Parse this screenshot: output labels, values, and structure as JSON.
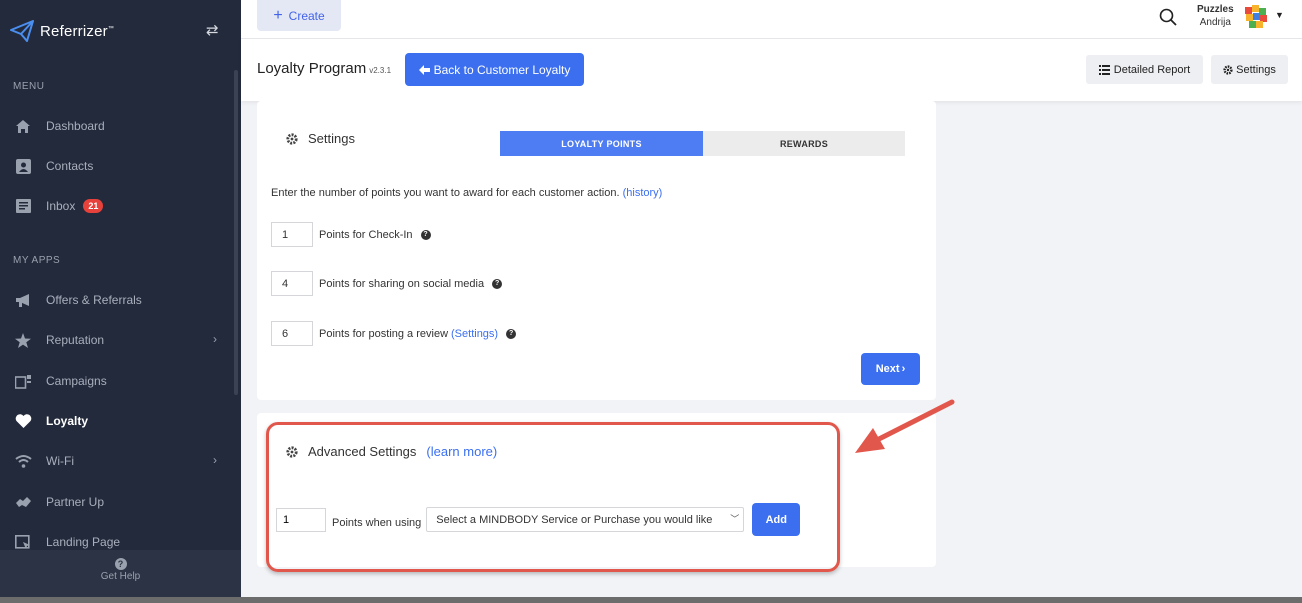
{
  "sidebar": {
    "brand": "Referrizer",
    "brand_tm": "™",
    "menu_label": "MENU",
    "menu_items": [
      {
        "label": "Dashboard",
        "icon": "home-icon"
      },
      {
        "label": "Contacts",
        "icon": "contact-card-icon"
      },
      {
        "label": "Inbox",
        "icon": "inbox-icon",
        "badge": "21"
      }
    ],
    "apps_label": "MY APPS",
    "app_items": [
      {
        "label": "Offers & Referrals",
        "icon": "megaphone-icon"
      },
      {
        "label": "Reputation",
        "icon": "star-icon",
        "has_chevron": true
      },
      {
        "label": "Campaigns",
        "icon": "campaigns-icon"
      },
      {
        "label": "Loyalty",
        "icon": "heart-icon",
        "active": true
      },
      {
        "label": "Wi-Fi",
        "icon": "wifi-icon",
        "has_chevron": true
      },
      {
        "label": "Partner Up",
        "icon": "handshake-icon"
      },
      {
        "label": "Landing Page",
        "icon": "landing-page-icon"
      }
    ],
    "get_help": "Get Help"
  },
  "topbar": {
    "create_label": "Create",
    "org_name": "Puzzles",
    "user_name": "Andrija"
  },
  "header": {
    "title": "Loyalty Program",
    "version": "v2.3.1",
    "back_button": "Back to Customer Loyalty",
    "detailed_report": "Detailed Report",
    "settings": "Settings"
  },
  "settings_card": {
    "heading": "Settings",
    "tabs": [
      {
        "label": "LOYALTY POINTS",
        "active": true
      },
      {
        "label": "REWARDS",
        "active": false
      }
    ],
    "intro": "Enter the number of points you want to award for each customer action.",
    "history_link": "(history)",
    "rows": [
      {
        "value": "1",
        "label": "Points for Check-In"
      },
      {
        "value": "4",
        "label": "Points for sharing on social media"
      },
      {
        "value": "6",
        "label": "Points for posting a review",
        "link": "(Settings)"
      }
    ],
    "next_button": "Next"
  },
  "advanced_card": {
    "heading": "Advanced Settings",
    "learn_more": "(learn more)",
    "points_value": "1",
    "points_label": "Points when using",
    "select_placeholder": "Select a MINDBODY Service or Purchase you would like",
    "add_button": "Add"
  },
  "colors": {
    "sidebar_bg": "#232a3b",
    "primary": "#3b6ff0",
    "annotation": "#e2574c"
  }
}
